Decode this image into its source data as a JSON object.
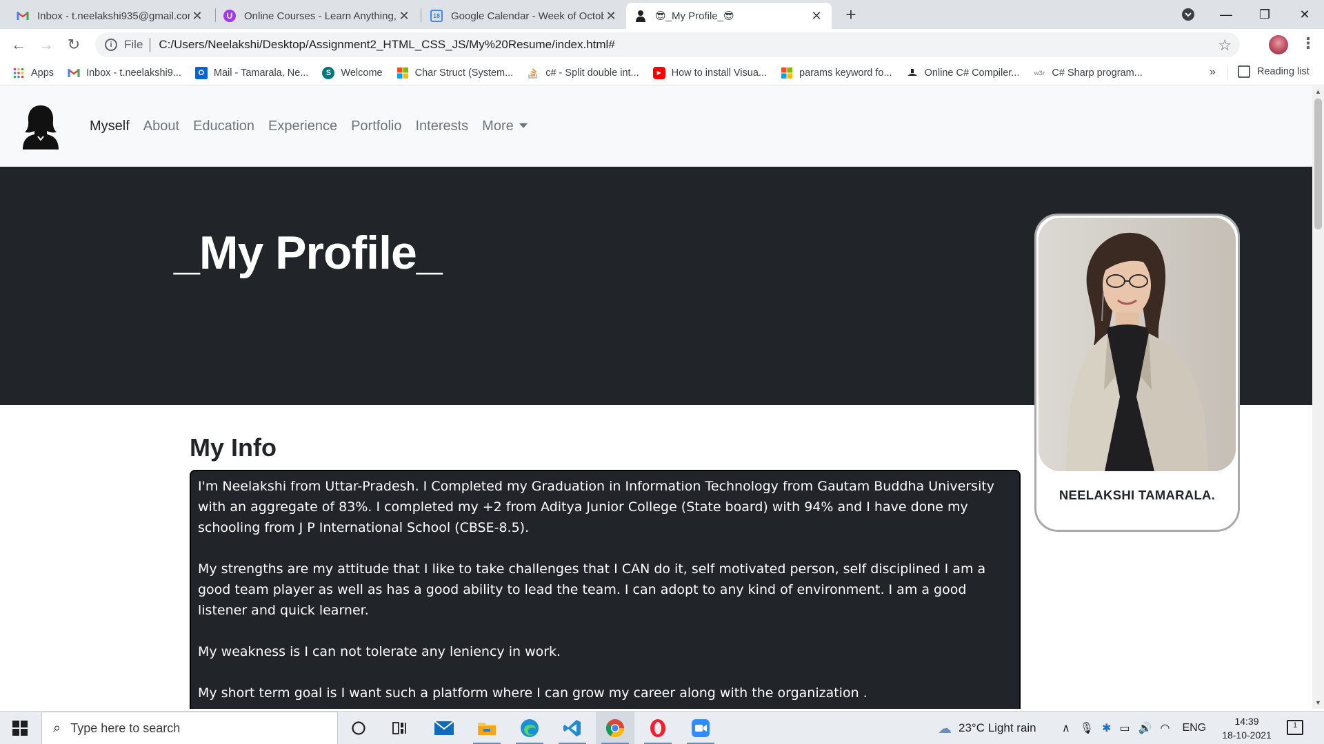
{
  "browser": {
    "tabs": [
      {
        "title": "Inbox - t.neelakshi935@gmail.com",
        "favicon": "gmail-icon",
        "active": false
      },
      {
        "title": "Online Courses - Learn Anything,",
        "favicon": "udemy-icon",
        "active": false
      },
      {
        "title": "Google Calendar - Week of Octob",
        "favicon": "calendar-icon",
        "active": false
      },
      {
        "title": "😎_My Profile_😎",
        "favicon": "profile-silhouette-icon",
        "active": true
      }
    ],
    "address": {
      "scheme": "File",
      "url": "C:/Users/Neelakshi/Desktop/Assignment2_HTML_CSS_JS/My%20Resume/index.html#"
    },
    "bookmarks": [
      {
        "label": "Apps",
        "icon": "apps-grid-icon"
      },
      {
        "label": "Inbox - t.neelakshi9...",
        "icon": "gmail-icon"
      },
      {
        "label": "Mail - Tamarala, Ne...",
        "icon": "outlook-icon"
      },
      {
        "label": "Welcome",
        "icon": "sharepoint-icon"
      },
      {
        "label": "Char Struct (System...",
        "icon": "microsoft-icon"
      },
      {
        "label": "c# - Split double int...",
        "icon": "stackoverflow-icon"
      },
      {
        "label": "How to install Visua...",
        "icon": "youtube-icon"
      },
      {
        "label": "params keyword fo...",
        "icon": "microsoft-icon"
      },
      {
        "label": "Online C# Compiler...",
        "icon": "compiler-icon"
      },
      {
        "label": "C# Sharp program...",
        "icon": "w3r-icon"
      }
    ],
    "bookmarks_overflow": "»",
    "reading_list": "Reading list"
  },
  "site": {
    "nav": {
      "links": [
        "Myself",
        "About",
        "Education",
        "Experience",
        "Portfolio",
        "Interests"
      ],
      "more": "More",
      "active_index": 0
    },
    "hero_title": "_My Profile_",
    "profile_name": "NEELAKSHI TAMARALA.",
    "info_heading": "My Info",
    "info_paragraphs": [
      "I'm Neelakshi from Uttar-Pradesh. I Completed my Graduation in Information Technology from Gautam Buddha University with an aggregate of 83%. I completed my +2 from Aditya Junior College (State board) with 94% and I have done my schooling from J P International School (CBSE-8.5).",
      "My strengths are my attitude that I like to take challenges that I CAN do it, self motivated person, self disciplined I am a good team player as well as has a good ability to lead the team. I can adopt to any kind of environment. I am a good listener and quick learner.",
      "My weakness is I can not tolerate any leniency in work.",
      "My short term goal is I want such a platform where I can grow my career along with the organization ."
    ]
  },
  "taskbar": {
    "search_placeholder": "Type here to search",
    "weather": "23°C  Light rain",
    "language": "ENG",
    "time": "14:39",
    "date": "18-10-2021",
    "notification_count": "1"
  },
  "colors": {
    "hero_bg": "#212529",
    "nav_bg": "#f8f9fa",
    "nav_active": "#212529",
    "nav_inactive": "#6c757d"
  }
}
